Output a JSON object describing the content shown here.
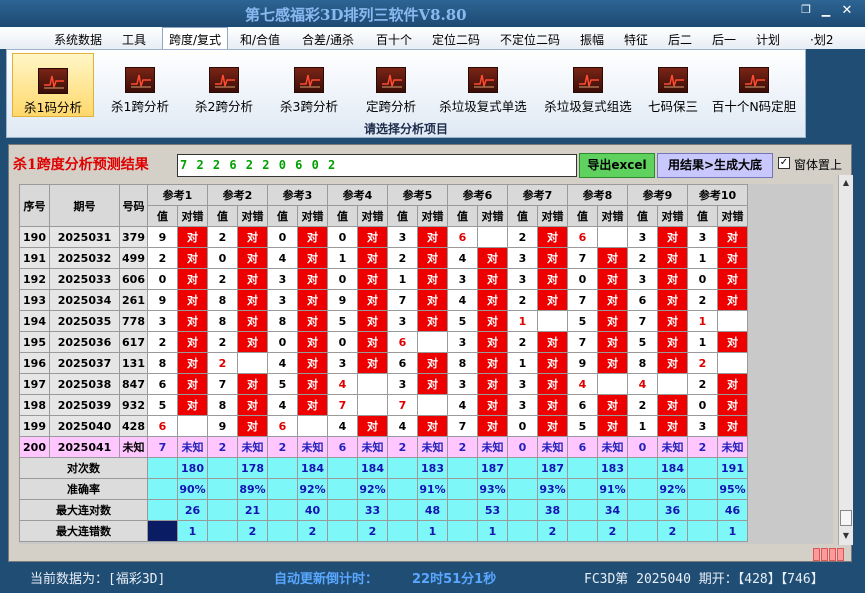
{
  "window": {
    "title": "第七感福彩3D排列三软件V8.80"
  },
  "menu": [
    {
      "label": "系统数据"
    },
    {
      "label": "工具"
    },
    {
      "label": "跨度/复式",
      "active": true
    },
    {
      "label": "和/合值"
    },
    {
      "label": "合差/通杀"
    },
    {
      "label": "百十个"
    },
    {
      "label": "定位二码"
    },
    {
      "label": "不定位二码"
    },
    {
      "label": "振幅"
    },
    {
      "label": "特征"
    },
    {
      "label": "后二"
    },
    {
      "label": "后一"
    },
    {
      "label": "计划"
    },
    {
      "label": "·划2"
    }
  ],
  "toolbar": {
    "items": [
      {
        "label": "杀1码分析",
        "icon": "chart-icon",
        "selected": true
      },
      {
        "label": "杀1跨分析",
        "icon": "chart-icon"
      },
      {
        "label": "杀2跨分析",
        "icon": "chart-icon"
      },
      {
        "label": "杀3跨分析",
        "icon": "chart-icon"
      },
      {
        "label": "定跨分析",
        "icon": "chart-icon"
      },
      {
        "label": "杀垃圾复式单选",
        "icon": "chart-icon"
      },
      {
        "label": "杀垃圾复式组选",
        "icon": "chart-icon"
      },
      {
        "label": "七码保三",
        "icon": "chart-icon"
      },
      {
        "label": "百十个N码定胆",
        "icon": "chart-icon"
      }
    ],
    "caption": "请选择分析项目"
  },
  "result": {
    "label": "杀1跨度分析预测结果",
    "value": "7 2 2 6 2 2 0 6 0 2",
    "export_label": "导出excel",
    "generate_label": "用结果>生成大底",
    "pin_checked": true,
    "pin_check_mark": "✓",
    "pin_label": "窗体置上"
  },
  "table": {
    "headers": {
      "index": "序号",
      "period": "期号",
      "number": "号码",
      "value": "值",
      "result": "对错"
    },
    "refs": [
      "参考1",
      "参考2",
      "参考3",
      "参考4",
      "参考5",
      "参考6",
      "参考7",
      "参考8",
      "参考9",
      "参考10"
    ],
    "rows": [
      {
        "idx": "190",
        "period": "2025031",
        "num": "379",
        "cells": [
          [
            "9",
            "对"
          ],
          [
            "2",
            "对"
          ],
          [
            "0",
            "对"
          ],
          [
            "0",
            "对"
          ],
          [
            "3",
            "对"
          ],
          [
            "6",
            "错"
          ],
          [
            "2",
            "对"
          ],
          [
            "6",
            "错"
          ],
          [
            "3",
            "对"
          ],
          [
            "3",
            "对"
          ]
        ]
      },
      {
        "idx": "191",
        "period": "2025032",
        "num": "499",
        "cells": [
          [
            "2",
            "对"
          ],
          [
            "0",
            "对"
          ],
          [
            "4",
            "对"
          ],
          [
            "1",
            "对"
          ],
          [
            "2",
            "对"
          ],
          [
            "4",
            "对"
          ],
          [
            "3",
            "对"
          ],
          [
            "7",
            "对"
          ],
          [
            "2",
            "对"
          ],
          [
            "1",
            "对"
          ]
        ]
      },
      {
        "idx": "192",
        "period": "2025033",
        "num": "606",
        "cells": [
          [
            "0",
            "对"
          ],
          [
            "2",
            "对"
          ],
          [
            "3",
            "对"
          ],
          [
            "0",
            "对"
          ],
          [
            "1",
            "对"
          ],
          [
            "3",
            "对"
          ],
          [
            "3",
            "对"
          ],
          [
            "0",
            "对"
          ],
          [
            "3",
            "对"
          ],
          [
            "0",
            "对"
          ]
        ]
      },
      {
        "idx": "193",
        "period": "2025034",
        "num": "261",
        "cells": [
          [
            "9",
            "对"
          ],
          [
            "8",
            "对"
          ],
          [
            "3",
            "对"
          ],
          [
            "9",
            "对"
          ],
          [
            "7",
            "对"
          ],
          [
            "4",
            "对"
          ],
          [
            "2",
            "对"
          ],
          [
            "7",
            "对"
          ],
          [
            "6",
            "对"
          ],
          [
            "2",
            "对"
          ]
        ]
      },
      {
        "idx": "194",
        "period": "2025035",
        "num": "778",
        "cells": [
          [
            "3",
            "对"
          ],
          [
            "8",
            "对"
          ],
          [
            "8",
            "对"
          ],
          [
            "5",
            "对"
          ],
          [
            "3",
            "对"
          ],
          [
            "5",
            "对"
          ],
          [
            "1",
            "错"
          ],
          [
            "5",
            "对"
          ],
          [
            "7",
            "对"
          ],
          [
            "1",
            "错"
          ]
        ]
      },
      {
        "idx": "195",
        "period": "2025036",
        "num": "617",
        "cells": [
          [
            "2",
            "对"
          ],
          [
            "2",
            "对"
          ],
          [
            "0",
            "对"
          ],
          [
            "0",
            "对"
          ],
          [
            "6",
            "错"
          ],
          [
            "3",
            "对"
          ],
          [
            "2",
            "对"
          ],
          [
            "7",
            "对"
          ],
          [
            "5",
            "对"
          ],
          [
            "1",
            "对"
          ]
        ]
      },
      {
        "idx": "196",
        "period": "2025037",
        "num": "131",
        "cells": [
          [
            "8",
            "对"
          ],
          [
            "2",
            "错"
          ],
          [
            "4",
            "对"
          ],
          [
            "3",
            "对"
          ],
          [
            "6",
            "对"
          ],
          [
            "8",
            "对"
          ],
          [
            "1",
            "对"
          ],
          [
            "9",
            "对"
          ],
          [
            "8",
            "对"
          ],
          [
            "2",
            "错"
          ]
        ]
      },
      {
        "idx": "197",
        "period": "2025038",
        "num": "847",
        "cells": [
          [
            "6",
            "对"
          ],
          [
            "7",
            "对"
          ],
          [
            "5",
            "对"
          ],
          [
            "4",
            "错"
          ],
          [
            "3",
            "对"
          ],
          [
            "3",
            "对"
          ],
          [
            "3",
            "对"
          ],
          [
            "4",
            "错"
          ],
          [
            "4",
            "错"
          ],
          [
            "2",
            "对"
          ]
        ]
      },
      {
        "idx": "198",
        "period": "2025039",
        "num": "932",
        "cells": [
          [
            "5",
            "对"
          ],
          [
            "8",
            "对"
          ],
          [
            "4",
            "对"
          ],
          [
            "7",
            "错"
          ],
          [
            "7",
            "错"
          ],
          [
            "4",
            "对"
          ],
          [
            "3",
            "对"
          ],
          [
            "6",
            "对"
          ],
          [
            "2",
            "对"
          ],
          [
            "0",
            "对"
          ]
        ]
      },
      {
        "idx": "199",
        "period": "2025040",
        "num": "428",
        "cells": [
          [
            "6",
            "错"
          ],
          [
            "9",
            "对"
          ],
          [
            "6",
            "错"
          ],
          [
            "4",
            "对"
          ],
          [
            "4",
            "对"
          ],
          [
            "7",
            "对"
          ],
          [
            "0",
            "对"
          ],
          [
            "5",
            "对"
          ],
          [
            "1",
            "对"
          ],
          [
            "3",
            "对"
          ]
        ]
      }
    ],
    "predict": {
      "idx": "200",
      "period": "2025041",
      "num": "未知",
      "cells": [
        [
          "7",
          "未知"
        ],
        [
          "2",
          "未知"
        ],
        [
          "2",
          "未知"
        ],
        [
          "6",
          "未知"
        ],
        [
          "2",
          "未知"
        ],
        [
          "2",
          "未知"
        ],
        [
          "0",
          "未知"
        ],
        [
          "6",
          "未知"
        ],
        [
          "0",
          "未知"
        ],
        [
          "2",
          "未知"
        ]
      ]
    },
    "stats": [
      {
        "label": "对次数",
        "values": [
          "180",
          "178",
          "184",
          "184",
          "183",
          "187",
          "187",
          "183",
          "184",
          "191"
        ]
      },
      {
        "label": "准确率",
        "values": [
          "90%",
          "89%",
          "92%",
          "92%",
          "91%",
          "93%",
          "93%",
          "91%",
          "92%",
          "95%"
        ]
      },
      {
        "label": "最大连对数",
        "values": [
          "26",
          "21",
          "40",
          "33",
          "48",
          "53",
          "38",
          "34",
          "36",
          "46"
        ]
      },
      {
        "label": "最大连错数",
        "values": [
          "1",
          "2",
          "2",
          "2",
          "1",
          "1",
          "2",
          "2",
          "2",
          "1"
        ]
      }
    ]
  },
  "status": {
    "current_data": "当前数据为：[福彩3D]",
    "countdown_label": "自动更新倒计时：",
    "countdown_value": "22时51分1秒",
    "issue_info": "FC3D第 2025040 期开：【428】【746】"
  },
  "colors": {
    "title_bg": "#1f4d74",
    "wrong_cell": "#ee0000",
    "stats_cell": "#7df7f7",
    "predict_row": "#ffc6ff",
    "text_blue": "#1313b5"
  }
}
